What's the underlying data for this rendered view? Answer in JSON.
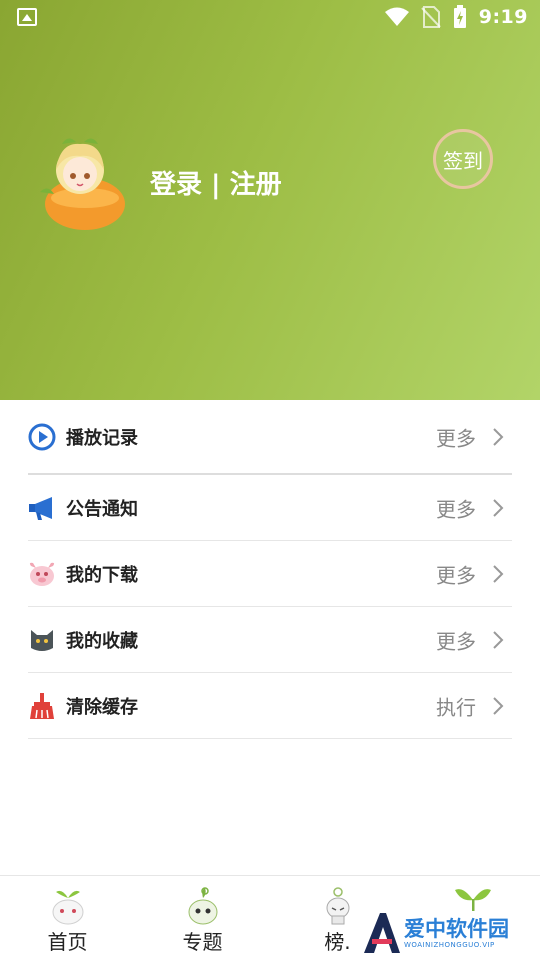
{
  "status_bar": {
    "time": "9:19"
  },
  "header": {
    "login_text": "登录 | 注册",
    "signin_label": "签到"
  },
  "menu": [
    {
      "label": "播放记录",
      "action": "更多",
      "icon": "play-circle-icon"
    },
    {
      "label": "公告通知",
      "action": "更多",
      "icon": "megaphone-icon"
    },
    {
      "label": "我的下载",
      "action": "更多",
      "icon": "pink-creature-icon"
    },
    {
      "label": "我的收藏",
      "action": "更多",
      "icon": "cat-icon"
    },
    {
      "label": "清除缓存",
      "action": "执行",
      "icon": "broom-icon"
    }
  ],
  "tabs": [
    {
      "label": "首页",
      "icon": "sprout-mascot-icon"
    },
    {
      "label": "专题",
      "icon": "sprout-mascot-icon"
    },
    {
      "label": "榜.",
      "icon": "sprout-mascot-icon"
    },
    {
      "label": "",
      "icon": "sprout-icon"
    }
  ],
  "watermark": {
    "title": "爱中软件园",
    "subtitle": "WOAINIZHONGGUO.VIP"
  },
  "colors": {
    "header_start": "#8aa632",
    "header_end": "#b2d468",
    "accent_blue": "#2a7fd6",
    "broom_red": "#e0413a"
  }
}
